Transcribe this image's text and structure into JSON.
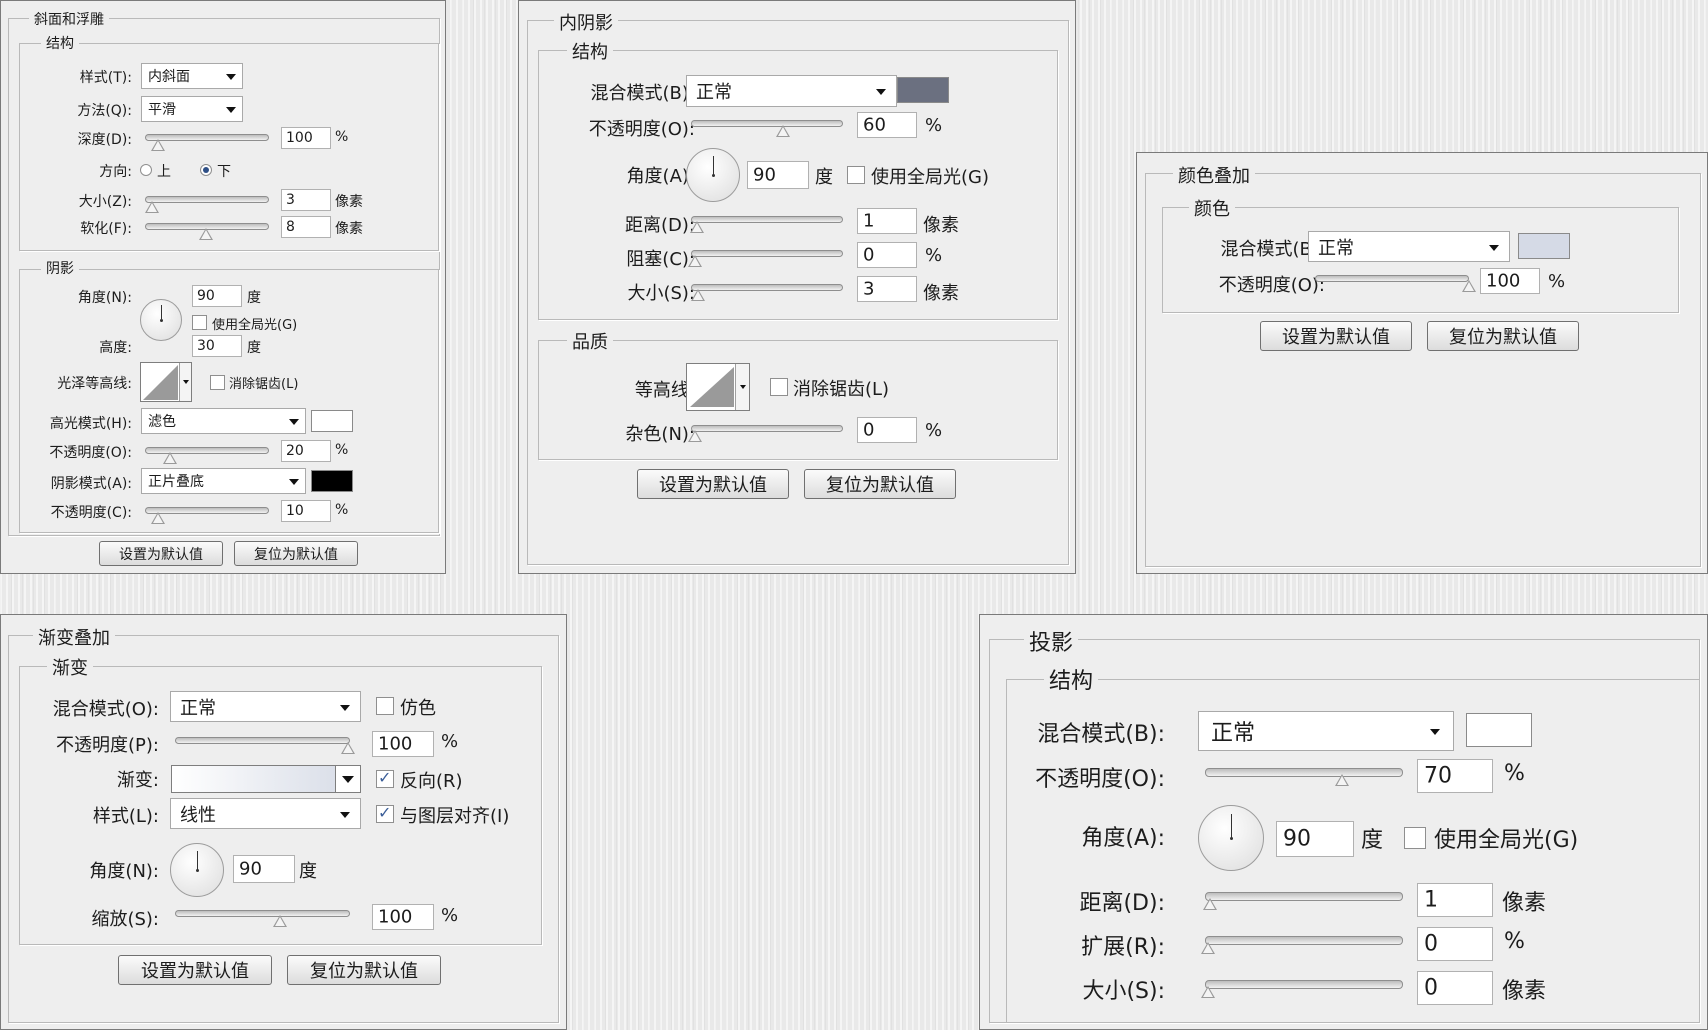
{
  "bevel": {
    "title": "斜面和浮雕",
    "structure": {
      "title": "结构",
      "style_label": "样式(T):",
      "style_value": "内斜面",
      "technique_label": "方法(Q):",
      "technique_value": "平滑",
      "depth_label": "深度(D):",
      "depth_value": "100",
      "depth_unit": "%",
      "direction_label": "方向:",
      "direction_up": "上",
      "direction_down": "下",
      "size_label": "大小(Z):",
      "size_value": "3",
      "size_unit": "像素",
      "soften_label": "软化(F):",
      "soften_value": "8",
      "soften_unit": "像素"
    },
    "shading": {
      "title": "阴影",
      "angle_label": "角度(N):",
      "angle_value": "90",
      "angle_unit": "度",
      "global_light_label": "使用全局光(G)",
      "altitude_label": "高度:",
      "altitude_value": "30",
      "altitude_unit": "度",
      "gloss_label": "光泽等高线:",
      "antialias_label": "消除锯齿(L)",
      "highlight_label": "高光模式(H):",
      "highlight_value": "滤色",
      "hl_opacity_label": "不透明度(O):",
      "hl_opacity_value": "20",
      "hl_opacity_unit": "%",
      "shadow_label": "阴影模式(A):",
      "shadow_value": "正片叠底",
      "sh_opacity_label": "不透明度(C):",
      "sh_opacity_value": "10",
      "sh_opacity_unit": "%"
    },
    "default_button": "设置为默认值",
    "reset_button": "复位为默认值",
    "highlight_color": "#ffffff",
    "shadow_color": "#000000"
  },
  "inner_shadow": {
    "title": "内阴影",
    "structure": {
      "title": "结构",
      "blend_label": "混合模式(B):",
      "blend_value": "正常",
      "opacity_label": "不透明度(O):",
      "opacity_value": "60",
      "opacity_unit": "%",
      "angle_label": "角度(A):",
      "angle_value": "90",
      "angle_unit": "度",
      "global_light_label": "使用全局光(G)",
      "distance_label": "距离(D):",
      "distance_value": "1",
      "distance_unit": "像素",
      "choke_label": "阻塞(C):",
      "choke_value": "0",
      "choke_unit": "%",
      "size_label": "大小(S):",
      "size_value": "3",
      "size_unit": "像素"
    },
    "quality": {
      "title": "品质",
      "contour_label": "等高线:",
      "antialias_label": "消除锯齿(L)",
      "noise_label": "杂色(N):",
      "noise_value": "0",
      "noise_unit": "%"
    },
    "default_button": "设置为默认值",
    "reset_button": "复位为默认值",
    "color": "#6b7080"
  },
  "color_overlay": {
    "title": "颜色叠加",
    "color_group": {
      "title": "颜色",
      "blend_label": "混合模式(B):",
      "blend_value": "正常",
      "opacity_label": "不透明度(O):",
      "opacity_value": "100",
      "opacity_unit": "%"
    },
    "default_button": "设置为默认值",
    "reset_button": "复位为默认值",
    "color": "#d5dae6"
  },
  "gradient_overlay": {
    "title": "渐变叠加",
    "gradient_group": {
      "title": "渐变",
      "blend_label": "混合模式(O):",
      "blend_value": "正常",
      "dither_label": "仿色",
      "opacity_label": "不透明度(P):",
      "opacity_value": "100",
      "opacity_unit": "%",
      "gradient_label": "渐变:",
      "reverse_label": "反向(R)",
      "style_label": "样式(L):",
      "style_value": "线性",
      "align_label": "与图层对齐(I)",
      "angle_label": "角度(N):",
      "angle_value": "90",
      "angle_unit": "度",
      "scale_label": "缩放(S):",
      "scale_value": "100",
      "scale_unit": "%"
    },
    "default_button": "设置为默认值",
    "reset_button": "复位为默认值"
  },
  "drop_shadow": {
    "title": "投影",
    "structure": {
      "title": "结构",
      "blend_label": "混合模式(B):",
      "blend_value": "正常",
      "opacity_label": "不透明度(O):",
      "opacity_value": "70",
      "opacity_unit": "%",
      "angle_label": "角度(A):",
      "angle_value": "90",
      "angle_unit": "度",
      "global_light_label": "使用全局光(G)",
      "distance_label": "距离(D):",
      "distance_value": "1",
      "distance_unit": "像素",
      "spread_label": "扩展(R):",
      "spread_value": "0",
      "spread_unit": "%",
      "size_label": "大小(S):",
      "size_value": "0",
      "size_unit": "像素"
    },
    "color": "#ffffff"
  }
}
